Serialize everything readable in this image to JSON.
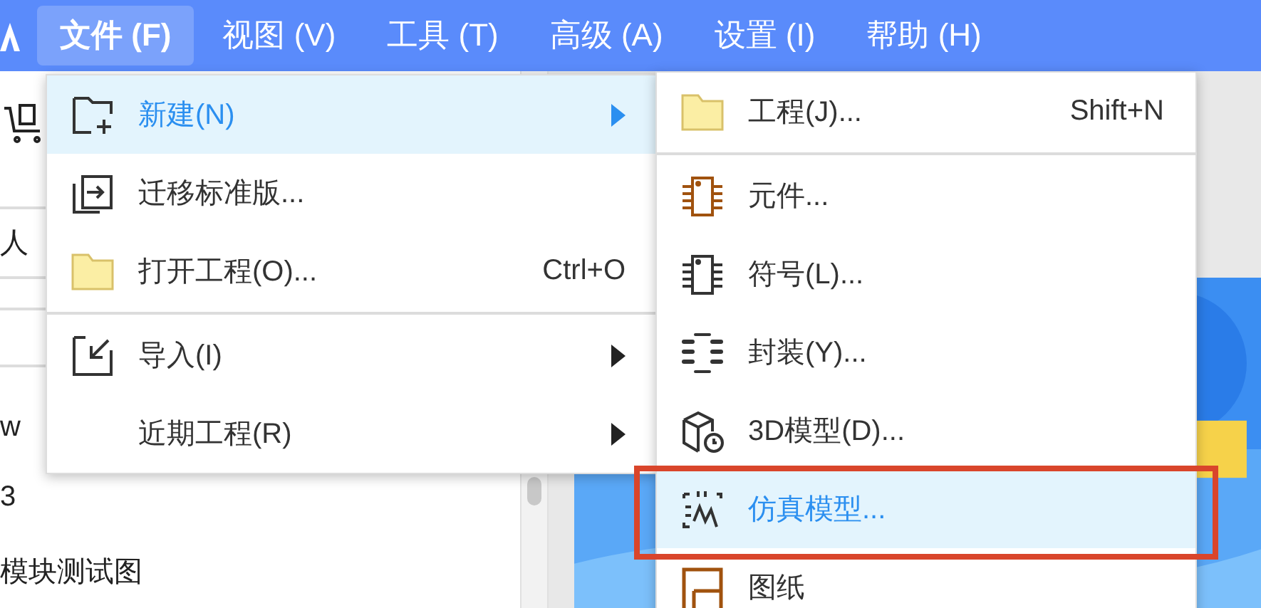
{
  "menubar": {
    "items": [
      {
        "label": "文件 (F)",
        "selected": true
      },
      {
        "label": "视图 (V)",
        "selected": false
      },
      {
        "label": "工具 (T)",
        "selected": false
      },
      {
        "label": "高级 (A)",
        "selected": false
      },
      {
        "label": "设置 (I)",
        "selected": false
      },
      {
        "label": "帮助 (H)",
        "selected": false
      }
    ]
  },
  "left_panel": {
    "items": [
      {
        "label": "人"
      },
      {
        "label": "w"
      },
      {
        "label": "3"
      },
      {
        "label": "模块测试图"
      }
    ]
  },
  "file_menu": {
    "items": [
      {
        "kind": "item",
        "label": "新建(N)",
        "submenu": true,
        "selected": true
      },
      {
        "kind": "item",
        "label": "迁移标准版...",
        "submenu": false,
        "selected": false
      },
      {
        "kind": "item",
        "label": "打开工程(O)...",
        "shortcut": "Ctrl+O",
        "submenu": false,
        "selected": false
      },
      {
        "kind": "divider"
      },
      {
        "kind": "item",
        "label": "导入(I)",
        "submenu": true,
        "selected": false
      },
      {
        "kind": "item",
        "label": "近期工程(R)",
        "submenu": true,
        "selected": false
      }
    ]
  },
  "new_submenu": {
    "items": [
      {
        "kind": "item",
        "label": "工程(J)...",
        "shortcut": "Shift+N",
        "selected": false,
        "outlined": false
      },
      {
        "kind": "divider"
      },
      {
        "kind": "item",
        "label": "元件...",
        "selected": false,
        "outlined": false
      },
      {
        "kind": "item",
        "label": "符号(L)...",
        "selected": false,
        "outlined": false
      },
      {
        "kind": "item",
        "label": "封装(Y)...",
        "selected": false,
        "outlined": false
      },
      {
        "kind": "item",
        "label": "3D模型(D)...",
        "selected": false,
        "outlined": false
      },
      {
        "kind": "item",
        "label": "仿真模型...",
        "selected": true,
        "outlined": true
      },
      {
        "kind": "item",
        "label": "图纸",
        "selected": false,
        "outlined": false
      }
    ]
  }
}
